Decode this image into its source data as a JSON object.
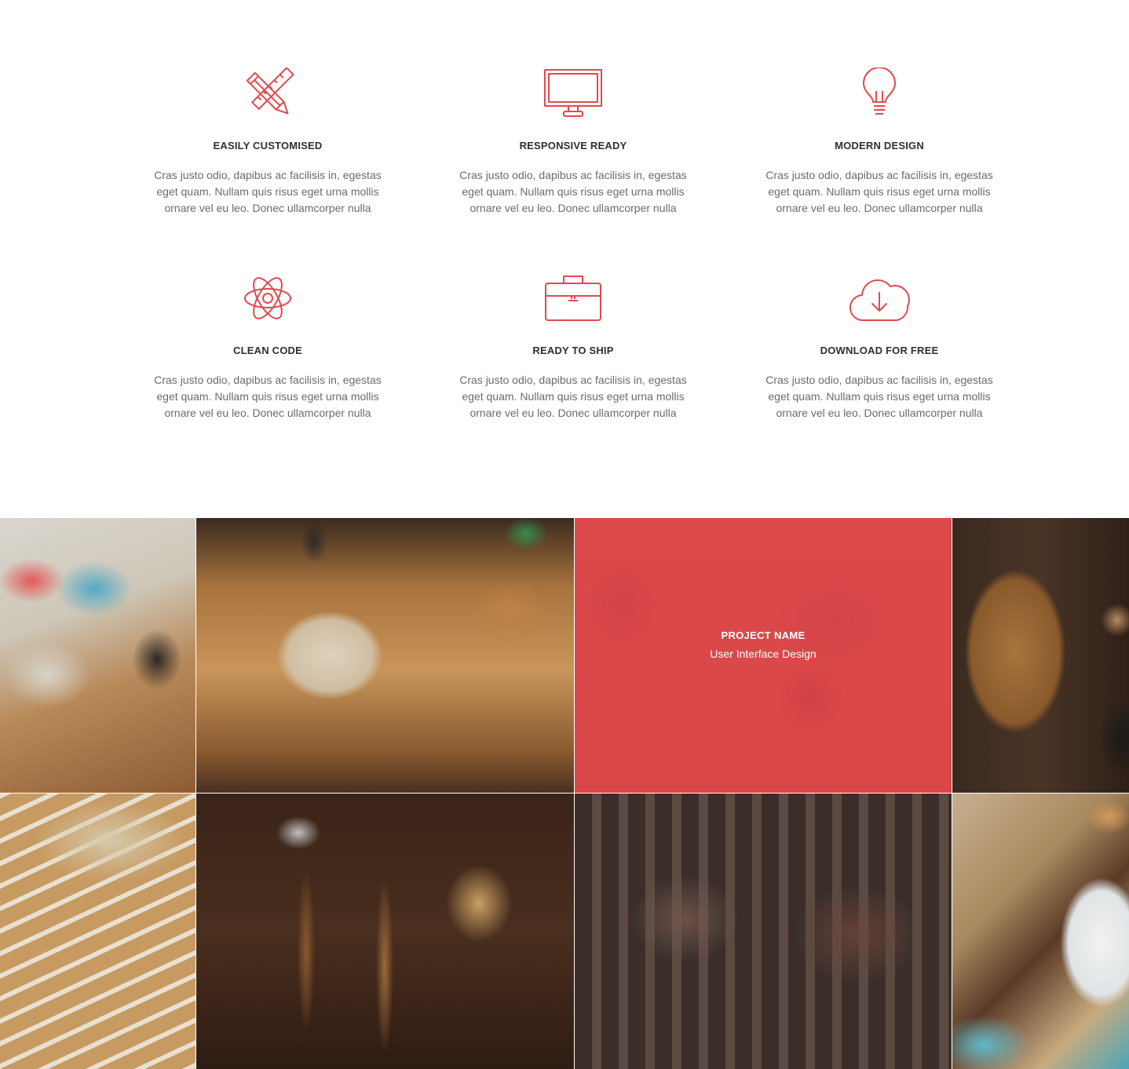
{
  "colors": {
    "accent": "#e04a4f",
    "heading": "#2f2f2f",
    "body_text": "#6b6b6b",
    "overlay": "#e84448"
  },
  "features": [
    {
      "icon": "pencil-ruler-icon",
      "title": "EASILY CUSTOMISED",
      "text": "Cras justo odio, dapibus ac facilisis in, egestas eget quam. Nullam quis risus eget urna mollis ornare vel eu leo. Donec ullamcorper nulla"
    },
    {
      "icon": "monitor-icon",
      "title": "RESPONSIVE READY",
      "text": "Cras justo odio, dapibus ac facilisis in, egestas eget quam. Nullam quis risus eget urna mollis ornare vel eu leo. Donec ullamcorper nulla"
    },
    {
      "icon": "lightbulb-icon",
      "title": "MODERN DESIGN",
      "text": "Cras justo odio, dapibus ac facilisis in, egestas eget quam. Nullam quis risus eget urna mollis ornare vel eu leo. Donec ullamcorper nulla"
    },
    {
      "icon": "atom-icon",
      "title": "CLEAN CODE",
      "text": "Cras justo odio, dapibus ac facilisis in, egestas eget quam. Nullam quis risus eget urna mollis ornare vel eu leo. Donec ullamcorper nulla"
    },
    {
      "icon": "briefcase-icon",
      "title": "READY TO SHIP",
      "text": "Cras justo odio, dapibus ac facilisis in, egestas eget quam. Nullam quis risus eget urna mollis ornare vel eu leo. Donec ullamcorper nulla"
    },
    {
      "icon": "cloud-download-icon",
      "title": "DOWNLOAD FOR FREE",
      "text": "Cras justo odio, dapibus ac facilisis in, egestas eget quam. Nullam quis risus eget urna mollis ornare vel eu leo. Donec ullamcorper nulla"
    }
  ],
  "portfolio": {
    "hover_item": {
      "name": "PROJECT NAME",
      "category": "User Interface Design"
    }
  }
}
